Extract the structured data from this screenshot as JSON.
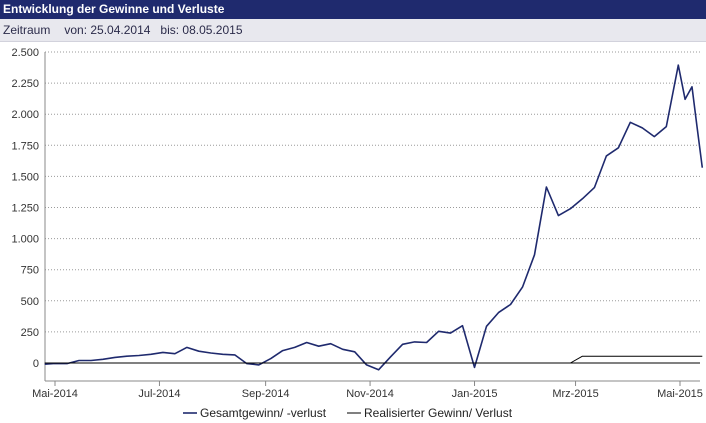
{
  "header": {
    "title": "Entwicklung der Gewinne und Verluste",
    "period_label": "Zeitraum",
    "from_text": "von: 25.04.2014",
    "to_text": "bis: 08.05.2015"
  },
  "chart_data": {
    "type": "line",
    "title": "Entwicklung der Gewinne und Verluste",
    "xlabel": "",
    "ylabel": "",
    "ylim": [
      -100,
      2500
    ],
    "yticks": [
      0,
      250,
      500,
      750,
      1000,
      1250,
      1500,
      1750,
      2000,
      2250,
      2500
    ],
    "ytick_labels": [
      "0",
      "250",
      "500",
      "750",
      "1.000",
      "1.250",
      "1.500",
      "1.750",
      "2.000",
      "2.250",
      "2.500"
    ],
    "xlim": [
      "2014-04-25",
      "2015-05-08"
    ],
    "xticks": [
      "2014-05-01",
      "2014-07-01",
      "2014-09-01",
      "2014-11-01",
      "2015-01-01",
      "2015-03-01",
      "2015-05-01"
    ],
    "xtick_labels": [
      "Mai-2014",
      "Jul-2014",
      "Sep-2014",
      "Nov-2014",
      "Jan-2015",
      "Mrz-2015",
      "Mai-2015"
    ],
    "grid": true,
    "legend_position": "bottom",
    "series": [
      {
        "name": "Gesamtgewinn/ -verlust",
        "color": "#1f2a6e",
        "points": [
          [
            "2014-04-25",
            -10
          ],
          [
            "2014-04-30",
            -5
          ],
          [
            "2014-05-08",
            -5
          ],
          [
            "2014-05-15",
            20
          ],
          [
            "2014-05-22",
            20
          ],
          [
            "2014-05-29",
            30
          ],
          [
            "2014-06-05",
            45
          ],
          [
            "2014-06-12",
            55
          ],
          [
            "2014-06-19",
            60
          ],
          [
            "2014-06-26",
            70
          ],
          [
            "2014-07-03",
            85
          ],
          [
            "2014-07-10",
            75
          ],
          [
            "2014-07-17",
            125
          ],
          [
            "2014-07-24",
            95
          ],
          [
            "2014-07-31",
            80
          ],
          [
            "2014-08-07",
            70
          ],
          [
            "2014-08-14",
            65
          ],
          [
            "2014-08-21",
            -5
          ],
          [
            "2014-08-28",
            -15
          ],
          [
            "2014-09-04",
            35
          ],
          [
            "2014-09-11",
            100
          ],
          [
            "2014-09-18",
            125
          ],
          [
            "2014-09-25",
            165
          ],
          [
            "2014-10-02",
            135
          ],
          [
            "2014-10-09",
            155
          ],
          [
            "2014-10-16",
            110
          ],
          [
            "2014-10-23",
            90
          ],
          [
            "2014-10-30",
            -15
          ],
          [
            "2014-11-06",
            -55
          ],
          [
            "2014-11-13",
            50
          ],
          [
            "2014-11-20",
            150
          ],
          [
            "2014-11-27",
            170
          ],
          [
            "2014-12-04",
            165
          ],
          [
            "2014-12-11",
            255
          ],
          [
            "2014-12-18",
            240
          ],
          [
            "2014-12-25",
            300
          ],
          [
            "2015-01-01",
            -35
          ],
          [
            "2015-01-08",
            295
          ],
          [
            "2015-01-15",
            405
          ],
          [
            "2015-01-22",
            470
          ],
          [
            "2015-01-29",
            610
          ],
          [
            "2015-02-05",
            870
          ],
          [
            "2015-02-12",
            1415
          ],
          [
            "2015-02-19",
            1185
          ],
          [
            "2015-02-26",
            1240
          ],
          [
            "2015-03-05",
            1320
          ],
          [
            "2015-03-12",
            1410
          ],
          [
            "2015-03-19",
            1665
          ],
          [
            "2015-03-26",
            1730
          ],
          [
            "2015-04-02",
            1935
          ],
          [
            "2015-04-09",
            1890
          ],
          [
            "2015-04-16",
            1820
          ],
          [
            "2015-04-23",
            1900
          ],
          [
            "2015-04-30",
            2395
          ],
          [
            "2015-05-04",
            2120
          ],
          [
            "2015-05-08",
            2220
          ],
          [
            "2015-05-11",
            1895
          ],
          [
            "2015-05-14",
            1570
          ]
        ]
      },
      {
        "name": "Realisierter Gewinn/ Verlust",
        "color": "#000000",
        "points": [
          [
            "2014-04-25",
            0
          ],
          [
            "2015-02-26",
            0
          ],
          [
            "2015-03-05",
            55
          ],
          [
            "2015-05-14",
            55
          ]
        ]
      }
    ]
  }
}
